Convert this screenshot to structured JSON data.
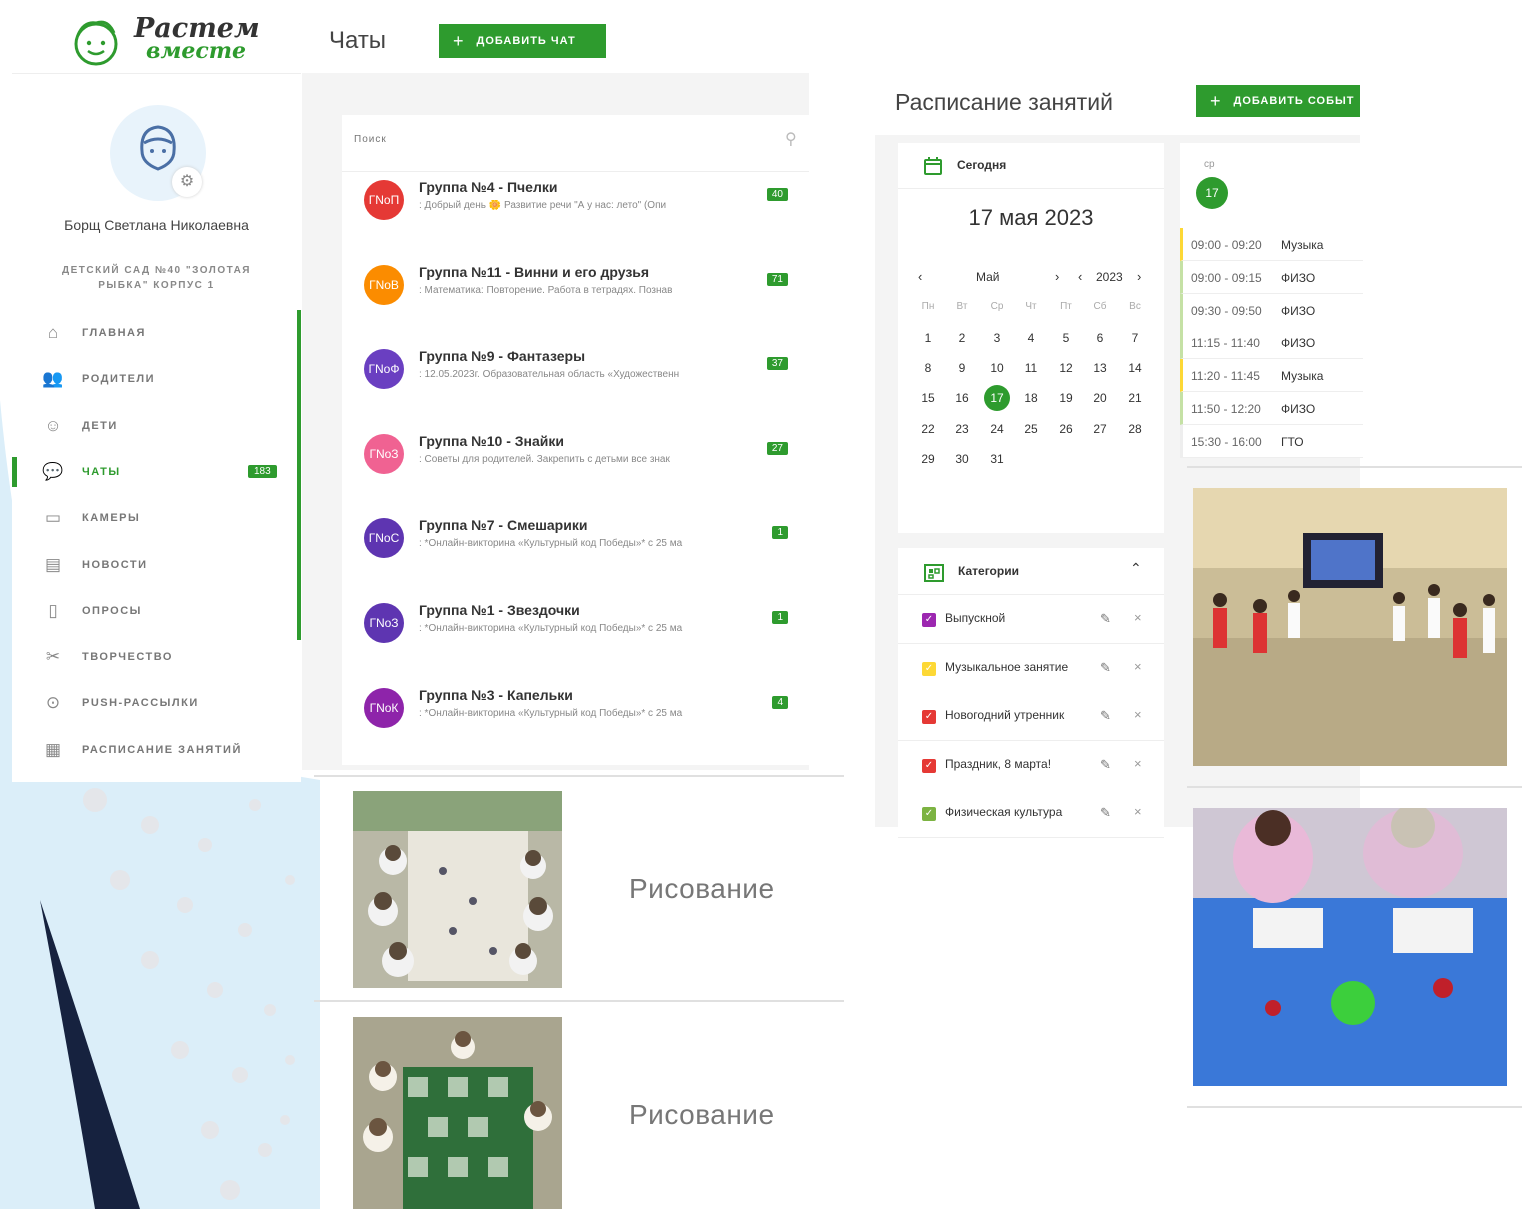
{
  "brand": {
    "line1": "Растем",
    "line2": "вместе",
    "green": "#2e9b2e"
  },
  "user": {
    "name": "Борщ Светлана Николаевна",
    "org_line1": "ДЕТСКИЙ САД №40 \"ЗОЛОТАЯ",
    "org_line2": "РЫБКА\" КОРПУС 1"
  },
  "nav": [
    {
      "label": "ГЛАВНАЯ",
      "icon": "home-icon",
      "active": false,
      "badge": ""
    },
    {
      "label": "РОДИТЕЛИ",
      "icon": "parents-icon",
      "active": false,
      "badge": ""
    },
    {
      "label": "ДЕТИ",
      "icon": "child-face-icon",
      "active": false,
      "badge": ""
    },
    {
      "label": "ЧАТЫ",
      "icon": "chat-icon",
      "active": true,
      "badge": "183"
    },
    {
      "label": "КАМЕРЫ",
      "icon": "camera-icon",
      "active": false,
      "badge": ""
    },
    {
      "label": "НОВОСТИ",
      "icon": "news-icon",
      "active": false,
      "badge": ""
    },
    {
      "label": "ОПРОСЫ",
      "icon": "clipboard-icon",
      "active": false,
      "badge": ""
    },
    {
      "label": "ТВОРЧЕСТВО",
      "icon": "scissors-icon",
      "active": false,
      "badge": ""
    },
    {
      "label": "PUSH-РАССЫЛКИ",
      "icon": "push-icon",
      "active": false,
      "badge": ""
    },
    {
      "label": "РАСПИСАНИЕ ЗАНЯТИЙ",
      "icon": "calendar-icon",
      "active": false,
      "badge": ""
    }
  ],
  "chats": {
    "title": "Чаты",
    "add_label": "ДОБАВИТЬ ЧАТ",
    "search_placeholder": "Поиск",
    "items": [
      {
        "avatar": "ГNoП",
        "color": "#e53935",
        "title": "Группа №4 - Пчелки",
        "preview": ": Добрый день 🌼 Развитие речи \"А у нас: лето\" (Опи",
        "badge": "40"
      },
      {
        "avatar": "ГNoВ",
        "color": "#fb8c00",
        "title": "Группа №11 - Винни и его друзья",
        "preview": ": Математика: Повторение. Работа в тетрадях. Познав",
        "badge": "71"
      },
      {
        "avatar": "ГNoФ",
        "color": "#6a3fc1",
        "title": "Группа №9 - Фантазеры",
        "preview": ": 12.05.2023г. Образовательная область «Художественн",
        "badge": "37"
      },
      {
        "avatar": "ГNoЗ",
        "color": "#f06292",
        "title": "Группа №10 - Знайки",
        "preview": ": Советы для родителей. Закрепить с детьми все знак",
        "badge": "27"
      },
      {
        "avatar": "ГNoС",
        "color": "#5e35b1",
        "title": "Группа №7 - Смешарики",
        "preview": ": *Онлайн-викторина «Культурный код Победы»* с 25 ма",
        "badge": "1"
      },
      {
        "avatar": "ГNoЗ",
        "color": "#5e35b1",
        "title": "Группа №1 - Звездочки",
        "preview": ": *Онлайн-викторина «Культурный код Победы»* с 25 ма",
        "badge": "1"
      },
      {
        "avatar": "ГNoК",
        "color": "#8e24aa",
        "title": "Группа №3 - Капельки",
        "preview": ": *Онлайн-викторина «Культурный код Победы»* с 25 ма",
        "badge": "4"
      }
    ]
  },
  "creative": [
    {
      "caption": "Рисование"
    },
    {
      "caption": "Рисование"
    }
  ],
  "schedule": {
    "title": "Расписание занятий",
    "add_label": "ДОБАВИТЬ СОБЫТ",
    "today_label": "Сегодня",
    "current_date": "17 мая 2023",
    "month": "Май",
    "year": "2023",
    "weekdays": [
      "Пн",
      "Вт",
      "Ср",
      "Чт",
      "Пт",
      "Сб",
      "Вс"
    ],
    "weeks": [
      [
        "1",
        "2",
        "3",
        "4",
        "5",
        "6",
        "7"
      ],
      [
        "8",
        "9",
        "10",
        "11",
        "12",
        "13",
        "14"
      ],
      [
        "15",
        "16",
        "17",
        "18",
        "19",
        "20",
        "21"
      ],
      [
        "22",
        "23",
        "24",
        "25",
        "26",
        "27",
        "28"
      ],
      [
        "29",
        "30",
        "31",
        "",
        "",
        "",
        ""
      ]
    ],
    "selected_day": "17",
    "categories_label": "Категории",
    "categories": [
      {
        "label": "Выпускной",
        "color": "#9c27b0"
      },
      {
        "label": "Музыкальное занятие",
        "color": "#fdd835"
      },
      {
        "label": "Новогодний утренник",
        "color": "#e53935"
      },
      {
        "label": "Праздник, 8 марта!",
        "color": "#e53935"
      },
      {
        "label": "Физическая культура",
        "color": "#7cb342"
      }
    ],
    "day_label": "ср",
    "day_number": "17",
    "events": [
      {
        "time": "09:00 - 09:20",
        "name": "Музыка",
        "color": "#fdd835"
      },
      {
        "time": "09:00 - 09:15",
        "name": "ФИЗО",
        "color": "#c5e1a5"
      },
      {
        "time": "09:30 - 09:50",
        "name": "ФИЗО",
        "color": "#c5e1a5"
      },
      {
        "time": "11:15 - 11:40",
        "name": "ФИЗО",
        "color": "#c5e1a5"
      },
      {
        "time": "11:20 - 11:45",
        "name": "Музыка",
        "color": "#fdd835"
      },
      {
        "time": "11:50 - 12:20",
        "name": "ФИЗО",
        "color": "#c5e1a5"
      },
      {
        "time": "15:30 - 16:00",
        "name": "ГТО",
        "color": "#eeeeee"
      }
    ]
  }
}
